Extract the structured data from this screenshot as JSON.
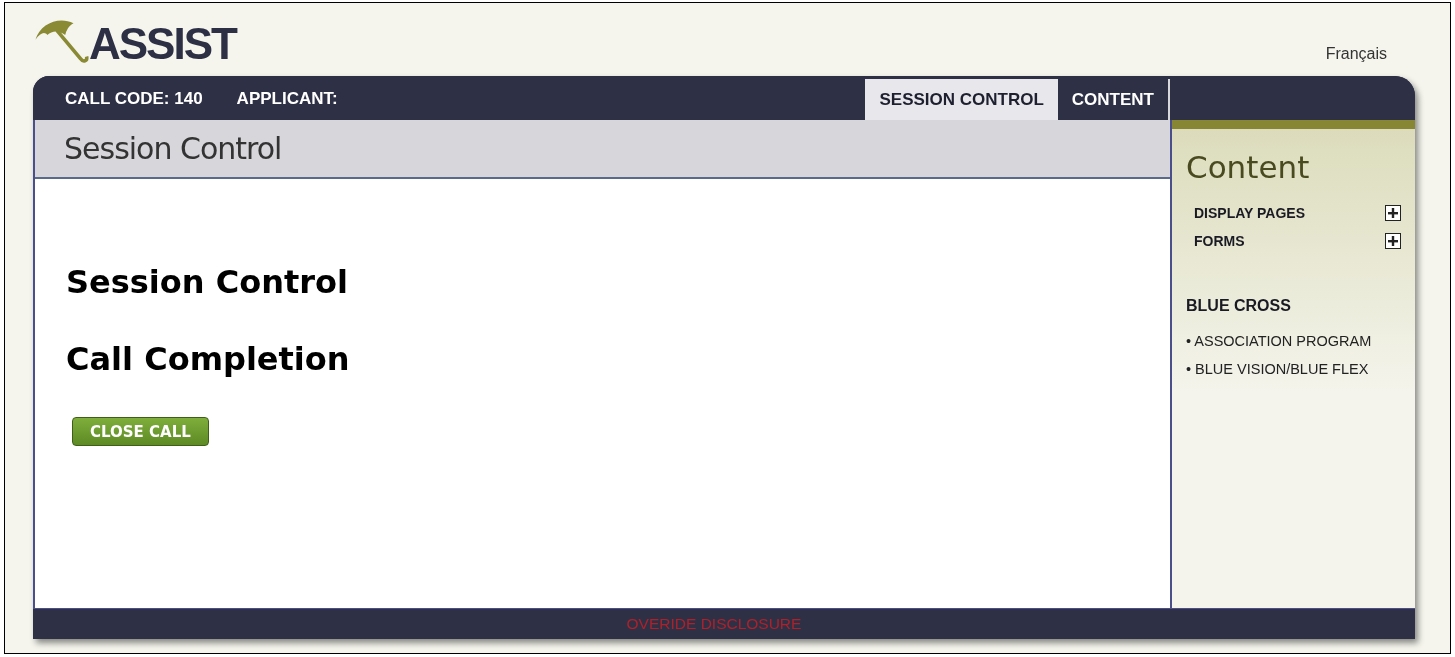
{
  "header": {
    "logo": "ASSIST",
    "language_link": "Français"
  },
  "top_bar": {
    "call_code": "CALL CODE: 140",
    "applicant": "APPLICANT:"
  },
  "tabs": [
    {
      "label": "SESSION CONTROL",
      "selected": true
    },
    {
      "label": "CONTENT",
      "selected": false
    }
  ],
  "main": {
    "page_title": "Session Control",
    "headings": [
      "Session Control",
      "Call Completion"
    ],
    "button": "CLOSE CALL"
  },
  "sidebar": {
    "title": "Content",
    "sections": [
      {
        "label": "DISPLAY PAGES",
        "expanded": false
      },
      {
        "label": "FORMS",
        "expanded": false
      }
    ],
    "group_title": "BLUE CROSS",
    "links": [
      "• ASSOCIATION PROGRAM",
      "• BLUE VISION/BLUE FLEX"
    ]
  },
  "footer": {
    "link": "OVERIDE DISCLOSURE"
  }
}
